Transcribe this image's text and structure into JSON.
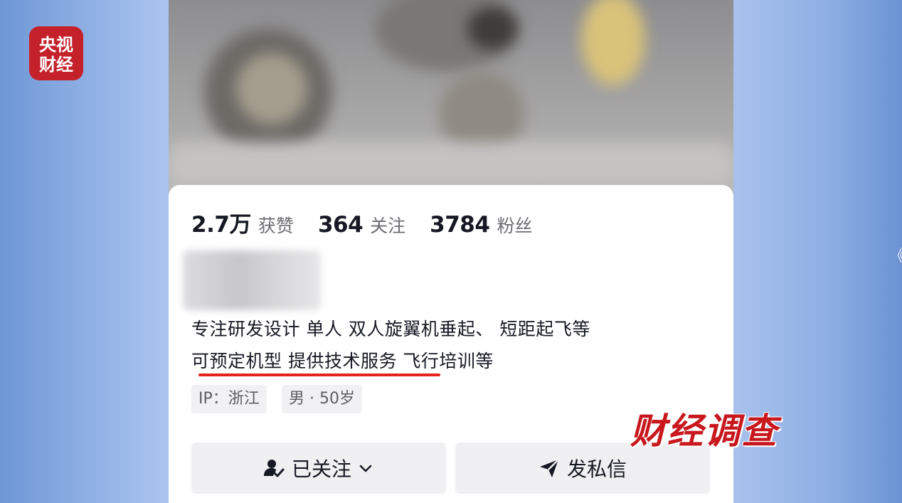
{
  "channel_logo": {
    "text": "央视财经",
    "color": "#c4212b"
  },
  "profile": {
    "stats": [
      {
        "value": "2.7万",
        "label": "获赞"
      },
      {
        "value": "364",
        "label": "关注"
      },
      {
        "value": "3784",
        "label": "粉丝"
      }
    ],
    "bio_line1": "专注研发设计 单人 双人旋翼机垂起、 短距起飞等",
    "bio_line2": " 可预定机型  提供技术服务  飞行培训等",
    "tags": {
      "ip": "IP：浙江",
      "gender_age": "男 · 50岁"
    },
    "buttons": {
      "follow_label": "已关注",
      "message_label": "发私信"
    }
  },
  "program_title": "财经调查",
  "side_arrow": "《",
  "colors": {
    "accent_red": "#e42418",
    "text_primary": "#161823",
    "text_secondary": "#6e6e73",
    "button_bg": "#f0f0f2"
  },
  "icons": [
    "user-check-icon",
    "chevron-down-icon",
    "send-icon"
  ]
}
